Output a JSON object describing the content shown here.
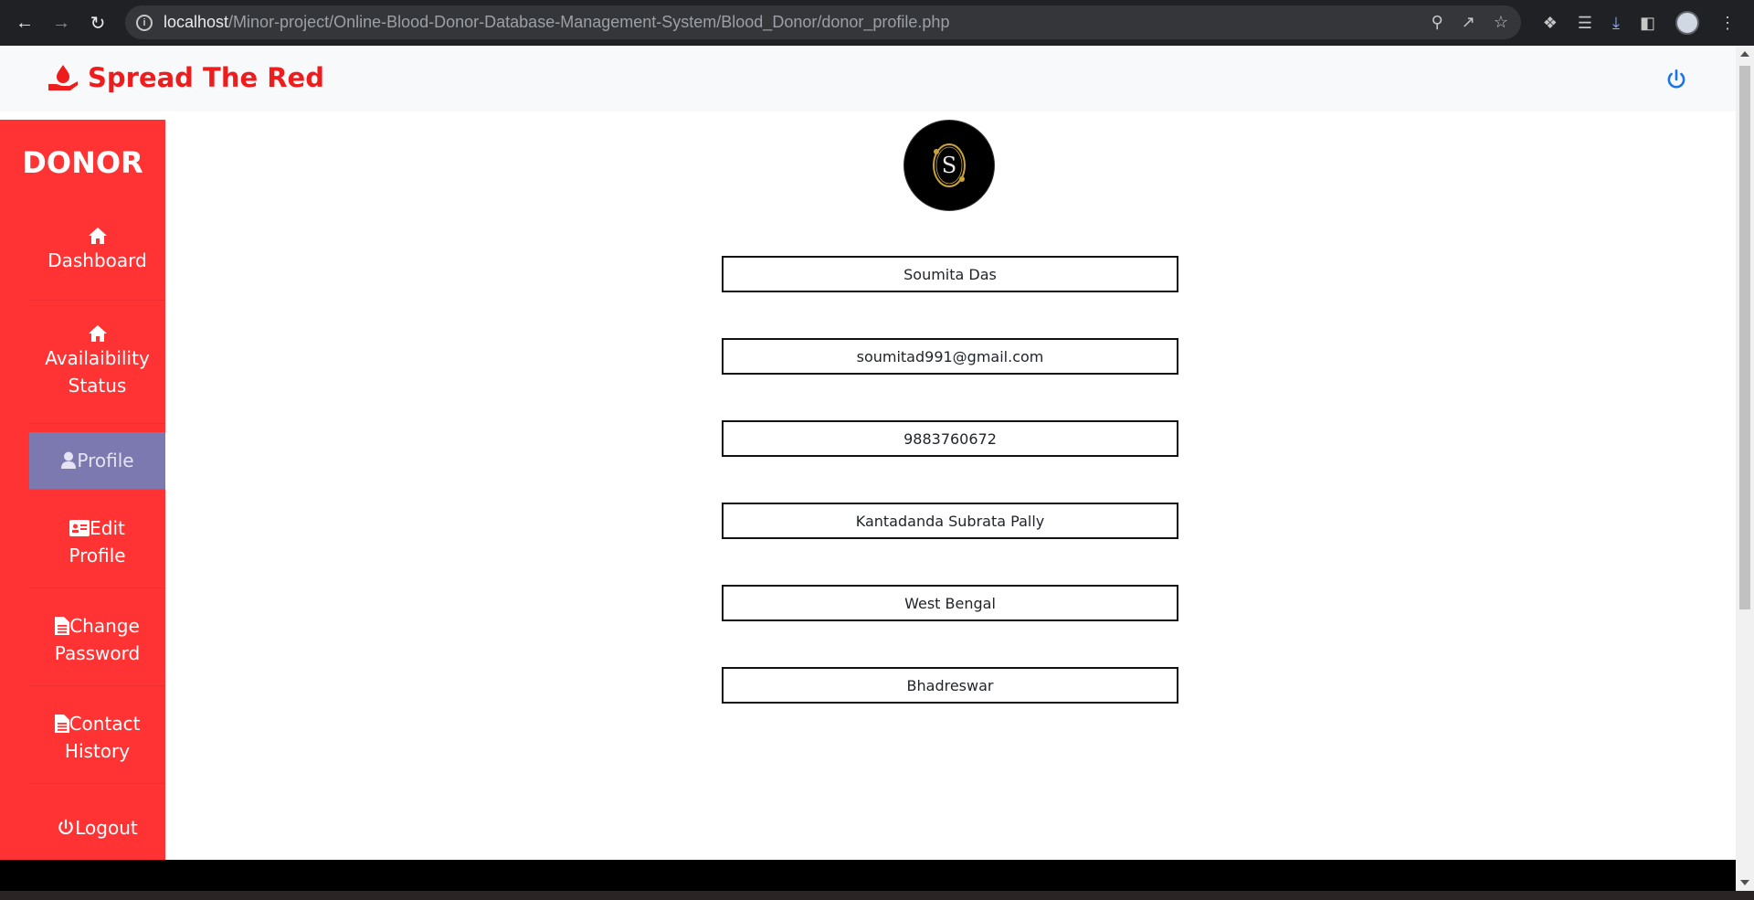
{
  "browser": {
    "url_host": "localhost",
    "url_path": "/Minor-project/Online-Blood-Donor-Database-Management-System/Blood_Donor/donor_profile.php"
  },
  "brand": {
    "name": "Spread The Red",
    "color": "#ee1c1c"
  },
  "sidebar": {
    "title": "DONOR",
    "color": "#ff3333",
    "active_color": "#7c78b0",
    "items": [
      {
        "line1": "Dashboard",
        "line2": "",
        "icon": "home-icon"
      },
      {
        "line1": "Availaibility",
        "line2": "Status",
        "icon": "home-icon"
      },
      {
        "line1": "Profile",
        "line2": "",
        "icon": "user-icon",
        "active": true
      },
      {
        "line1": "Edit",
        "line2": "Profile",
        "icon": "id-card-icon"
      },
      {
        "line1": "Change",
        "line2": "Password",
        "icon": "file-icon"
      },
      {
        "line1": "Contact",
        "line2": "History",
        "icon": "file-icon"
      },
      {
        "line1": "Logout",
        "line2": "",
        "icon": "power-icon"
      }
    ]
  },
  "profile": {
    "avatar_letter": "S",
    "fields": [
      {
        "name": "name-field",
        "value": "Soumita Das"
      },
      {
        "name": "email-field",
        "value": "soumitad991@gmail.com"
      },
      {
        "name": "phone-field",
        "value": "9883760672"
      },
      {
        "name": "address-field",
        "value": "Kantadanda Subrata Pally"
      },
      {
        "name": "state-field",
        "value": "West Bengal"
      },
      {
        "name": "city-field",
        "value": "Bhadreswar"
      }
    ]
  }
}
